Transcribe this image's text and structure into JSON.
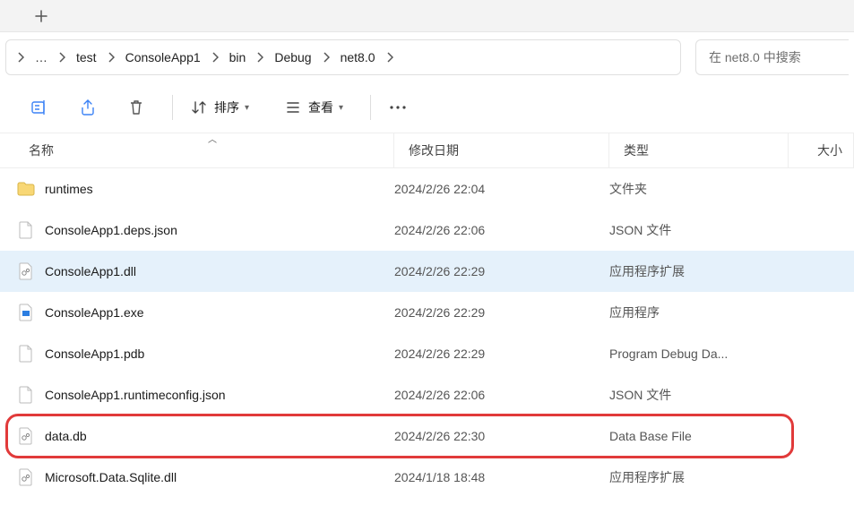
{
  "breadcrumb": {
    "overflow": "…",
    "items": [
      "test",
      "ConsoleApp1",
      "bin",
      "Debug",
      "net8.0"
    ]
  },
  "search": {
    "placeholder": "在 net8.0 中搜索"
  },
  "toolbar": {
    "sort_label": "排序",
    "view_label": "查看"
  },
  "columns": {
    "name": "名称",
    "date": "修改日期",
    "type": "类型",
    "size": "大小"
  },
  "files": [
    {
      "icon": "folder",
      "name": "runtimes",
      "date": "2024/2/26 22:04",
      "type": "文件夹",
      "selected": false,
      "highlighted": false
    },
    {
      "icon": "json",
      "name": "ConsoleApp1.deps.json",
      "date": "2024/2/26 22:06",
      "type": "JSON 文件",
      "selected": false,
      "highlighted": false
    },
    {
      "icon": "dll",
      "name": "ConsoleApp1.dll",
      "date": "2024/2/26 22:29",
      "type": "应用程序扩展",
      "selected": true,
      "highlighted": false
    },
    {
      "icon": "exe",
      "name": "ConsoleApp1.exe",
      "date": "2024/2/26 22:29",
      "type": "应用程序",
      "selected": false,
      "highlighted": false
    },
    {
      "icon": "file",
      "name": "ConsoleApp1.pdb",
      "date": "2024/2/26 22:29",
      "type": "Program Debug Da...",
      "selected": false,
      "highlighted": false
    },
    {
      "icon": "json",
      "name": "ConsoleApp1.runtimeconfig.json",
      "date": "2024/2/26 22:06",
      "type": "JSON 文件",
      "selected": false,
      "highlighted": false
    },
    {
      "icon": "db",
      "name": "data.db",
      "date": "2024/2/26 22:30",
      "type": "Data Base File",
      "selected": false,
      "highlighted": true
    },
    {
      "icon": "dll",
      "name": "Microsoft.Data.Sqlite.dll",
      "date": "2024/1/18 18:48",
      "type": "应用程序扩展",
      "selected": false,
      "highlighted": false
    }
  ]
}
